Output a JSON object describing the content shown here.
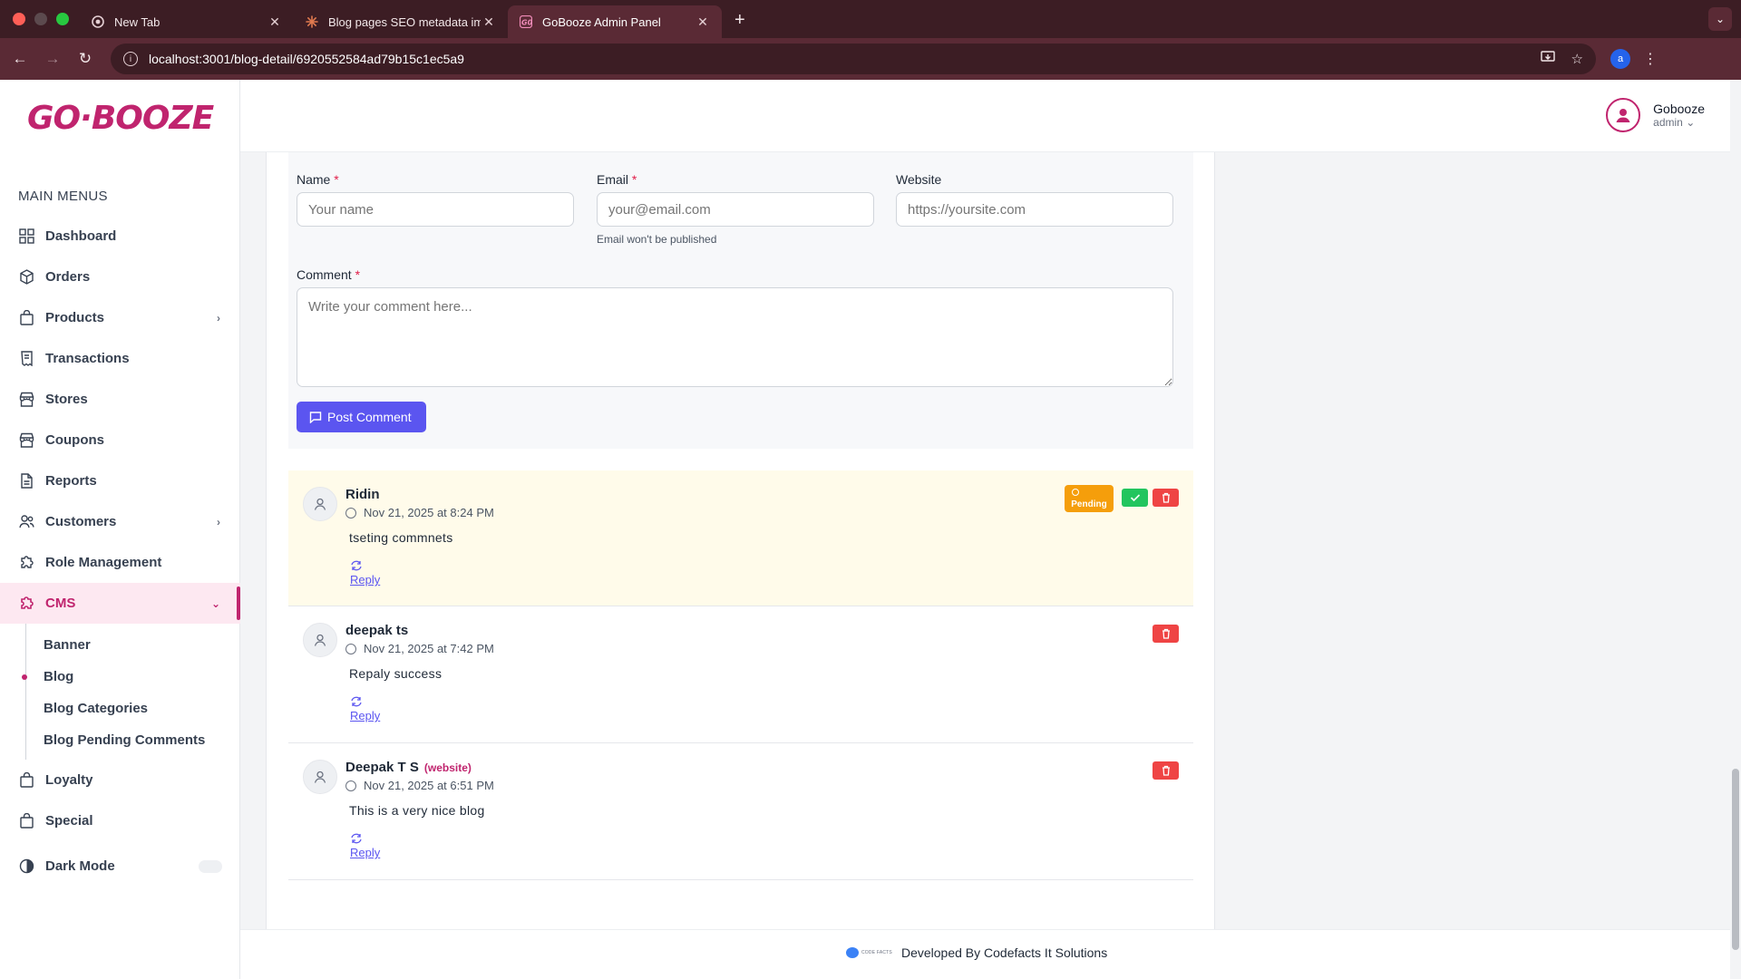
{
  "browser": {
    "tabs": [
      {
        "title": "New Tab",
        "icon": "chrome-icon",
        "active": false
      },
      {
        "title": "Blog pages SEO metadata im",
        "icon": "claude-icon",
        "active": false
      },
      {
        "title": "GoBooze Admin Panel",
        "icon": "gobooze-favicon",
        "active": true
      }
    ],
    "url": "localhost:3001/blog-detail/6920552584ad79b15c1ec5a9",
    "profile_initial": "a"
  },
  "app": {
    "logo": "GO·BOOZE",
    "brand_color": "#c0246e",
    "menu_heading": "MAIN MENUS",
    "menu": [
      {
        "label": "Dashboard",
        "icon": "dashboard-icon",
        "has_chevron": false
      },
      {
        "label": "Orders",
        "icon": "box-icon",
        "has_chevron": false
      },
      {
        "label": "Products",
        "icon": "bag-icon",
        "has_chevron": true
      },
      {
        "label": "Transactions",
        "icon": "receipt-icon",
        "has_chevron": false
      },
      {
        "label": "Stores",
        "icon": "store-icon",
        "has_chevron": false
      },
      {
        "label": "Coupons",
        "icon": "store-icon",
        "has_chevron": false
      },
      {
        "label": "Reports",
        "icon": "document-icon",
        "has_chevron": false
      },
      {
        "label": "Customers",
        "icon": "users-icon",
        "has_chevron": true
      },
      {
        "label": "Role Management",
        "icon": "puzzle-icon",
        "has_chevron": false
      },
      {
        "label": "CMS",
        "icon": "puzzle-icon",
        "has_chevron": true,
        "active": true
      }
    ],
    "cms_submenu": [
      {
        "label": "Banner"
      },
      {
        "label": "Blog",
        "active": true
      },
      {
        "label": "Blog Categories"
      },
      {
        "label": "Blog Pending Comments"
      }
    ],
    "menu_after": [
      {
        "label": "Loyalty",
        "icon": "bag-icon"
      },
      {
        "label": "Special",
        "icon": "bag-icon"
      }
    ],
    "dark_mode_label": "Dark Mode",
    "user": {
      "name": "Gobooze",
      "role": "admin"
    }
  },
  "form": {
    "name_label": "Name",
    "name_placeholder": "Your name",
    "email_label": "Email",
    "email_placeholder": "your@email.com",
    "email_hint": "Email won't be published",
    "website_label": "Website",
    "website_placeholder": "https://yoursite.com",
    "comment_label": "Comment",
    "comment_placeholder": "Write your comment here...",
    "required_mark": "*",
    "submit_label": "Post Comment",
    "submit_color": "#5b55f0"
  },
  "comments": [
    {
      "name": "Ridin",
      "tag": "",
      "date": "Nov 21, 2025 at 8:24 PM",
      "text": "tseting commnets",
      "reply_label": "Reply",
      "status": "Pending",
      "pending": true
    },
    {
      "name": "deepak ts",
      "tag": "",
      "date": "Nov 21, 2025 at 7:42 PM",
      "text": "Repaly success",
      "reply_label": "Reply",
      "status": "",
      "pending": false
    },
    {
      "name": "Deepak T S",
      "tag": "(website)",
      "date": "Nov 21, 2025 at 6:51 PM",
      "text": "This is a very nice blog",
      "reply_label": "Reply",
      "status": "",
      "pending": false
    }
  ],
  "footer": {
    "logo_text": "CODE FACTS",
    "credit": "Developed By Codefacts It Solutions"
  }
}
